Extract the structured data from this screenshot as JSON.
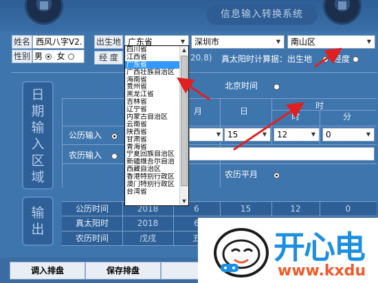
{
  "app": {
    "title": "信息输入转换系统"
  },
  "form": {
    "name_label": "姓名",
    "name_value": "西风八字V2.",
    "gender_label": "性别",
    "gender_male": "男",
    "gender_female": "女",
    "gender_selected": "男",
    "birthplace_label": "出生地",
    "province_value": "广东省",
    "city_value": "深圳市",
    "district_value": "南山区",
    "longitude_label": "经 度",
    "longitude_partial": "20.8)",
    "solar_time_text": "真太阳时计算",
    "solar_time_suffix": "据：出生地",
    "opt_birthplace": "出生地",
    "opt_longitude": "经度",
    "beijing_time": "北京时间"
  },
  "date_section": {
    "title_chars": [
      "日",
      "期",
      "输",
      "入",
      "区",
      "域"
    ],
    "col_month": "月",
    "col_day": "日",
    "col_time": "时",
    "col_hour": "时",
    "col_minute": "分",
    "gregorian_input": "公历输入",
    "lunar_input": "农历输入",
    "day_value": "15",
    "hour_value": "12",
    "minute_value": "0",
    "lunar_leap": "农历平月"
  },
  "province_dropdown": {
    "items": [
      "四川省",
      "江西省",
      "广东省",
      "广西壮族自治区",
      "海南省",
      "贵州省",
      "黑龙江省",
      "吉林省",
      "辽宁省",
      "内蒙古自治区",
      "云南省",
      "陕西省",
      "甘肃省",
      "青海省",
      "宁夏回族自治区",
      "新疆维吾尔自治",
      "西藏自治区",
      "香港特别行政区",
      "澳门特别行政区",
      "台湾省"
    ],
    "selected": "广东省"
  },
  "output_section": {
    "title_chars": [
      "输",
      "出"
    ],
    "rows": [
      {
        "label": "公历时间",
        "year": "2018",
        "month": "6",
        "day": "15",
        "hour": "12",
        "minute": "0"
      },
      {
        "label": "真太阳时",
        "year": "2018",
        "month": "6"
      },
      {
        "label": "农历时间",
        "year": "戊戌",
        "month": "五"
      }
    ]
  },
  "buttons": {
    "import": "调入排盘",
    "save": "保存排盘"
  },
  "watermark": {
    "brand": "开心电",
    "url": "www.kxdu"
  },
  "colors": {
    "background": "#3f75ad",
    "highlight": "#3399ff",
    "arrow": "#e02020",
    "brand_blue": "#1d8fe0",
    "brand_orange": "#f05a2a"
  }
}
